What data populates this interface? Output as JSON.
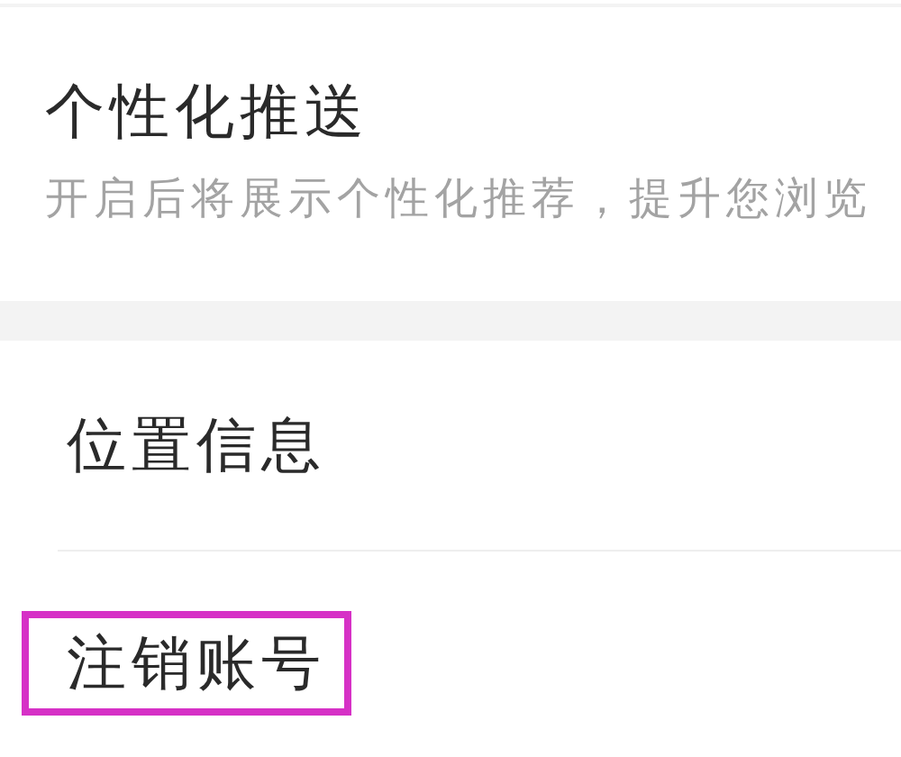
{
  "sections": [
    {
      "items": [
        {
          "title": "个性化推送",
          "description": "开启后将展示个性化推荐，提升您浏览",
          "highlighted": false
        }
      ]
    },
    {
      "items": [
        {
          "title": "位置信息",
          "highlighted": false
        },
        {
          "title": "注销账号",
          "highlighted": true
        }
      ]
    }
  ]
}
